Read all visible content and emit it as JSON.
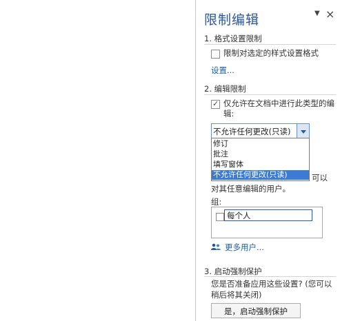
{
  "pane": {
    "title": "限制编辑",
    "menu_glyph": "▼",
    "close_glyph": "×"
  },
  "section1": {
    "heading": "1. 格式设置限制",
    "checkbox_label": "限制对选定的样式设置格式",
    "checkbox_checked": false,
    "settings_link": "设置..."
  },
  "section2": {
    "heading": "2. 编辑限制",
    "checkbox_label": "仅允许在文档中进行此类型的编辑:",
    "checkbox_checked": true,
    "combo_value": "不允许任何更改(只读)",
    "dropdown_options": [
      "修订",
      "批注",
      "填写窗体",
      "不允许任何更改(只读)"
    ],
    "dropdown_selected_index": 3,
    "partial_text_line1": "可以",
    "partial_text_line2": "对其任意编辑的用户。",
    "group_label": "组:",
    "group_name": "每个人",
    "group_checked": false,
    "more_users_link": "更多用户..."
  },
  "section3": {
    "heading": "3. 启动强制保护",
    "description": "您是否准备应用这些设置? (您可以稍后将其关闭)",
    "button_label": "是，启动强制保护"
  },
  "colors": {
    "accent": "#2b579a",
    "link": "#1e5fa3",
    "selection": "#3a7bd5"
  }
}
